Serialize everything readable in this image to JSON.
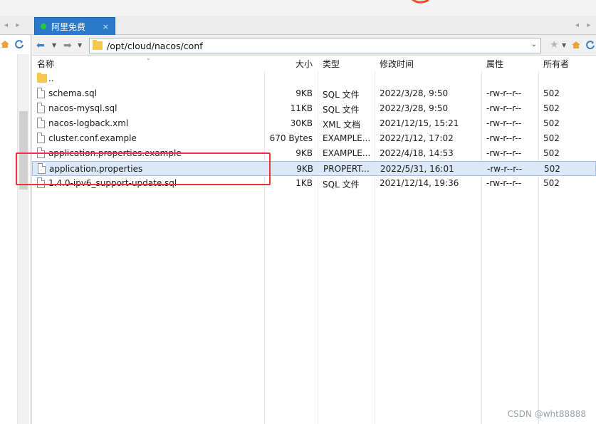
{
  "tab": {
    "label": "阿里免费",
    "close": "×"
  },
  "path": {
    "value": "/opt/cloud/nacos/conf"
  },
  "columns": {
    "name": "名称",
    "size": "大小",
    "type": "类型",
    "mtime": "修改时间",
    "perm": "属性",
    "owner": "所有者"
  },
  "files": [
    {
      "name": "..",
      "size": "",
      "type": "",
      "mtime": "",
      "perm": "",
      "owner": ""
    },
    {
      "name": "schema.sql",
      "size": "9KB",
      "type": "SQL 文件",
      "mtime": "2022/3/28, 9:50",
      "perm": "-rw-r--r--",
      "owner": "502"
    },
    {
      "name": "nacos-mysql.sql",
      "size": "11KB",
      "type": "SQL 文件",
      "mtime": "2022/3/28, 9:50",
      "perm": "-rw-r--r--",
      "owner": "502"
    },
    {
      "name": "nacos-logback.xml",
      "size": "30KB",
      "type": "XML 文档",
      "mtime": "2021/12/15, 15:21",
      "perm": "-rw-r--r--",
      "owner": "502"
    },
    {
      "name": "cluster.conf.example",
      "size": "670 Bytes",
      "type": "EXAMPLE...",
      "mtime": "2022/1/12, 17:02",
      "perm": "-rw-r--r--",
      "owner": "502"
    },
    {
      "name": "application.properties.example",
      "size": "9KB",
      "type": "EXAMPLE...",
      "mtime": "2022/4/18, 14:53",
      "perm": "-rw-r--r--",
      "owner": "502"
    },
    {
      "name": "application.properties",
      "size": "9KB",
      "type": "PROPERT...",
      "mtime": "2022/5/31, 16:01",
      "perm": "-rw-r--r--",
      "owner": "502"
    },
    {
      "name": "1.4.0-ipv6_support-update.sql",
      "size": "1KB",
      "type": "SQL 文件",
      "mtime": "2021/12/14, 19:36",
      "perm": "-rw-r--r--",
      "owner": "502"
    }
  ],
  "selected_index": 6,
  "watermark": "CSDN @wht88888",
  "colors": {
    "tab_bg": "#2b79c9",
    "selection_bg": "#dbe8f7",
    "highlight_border": "#e53935",
    "folder": "#f5c84c"
  }
}
